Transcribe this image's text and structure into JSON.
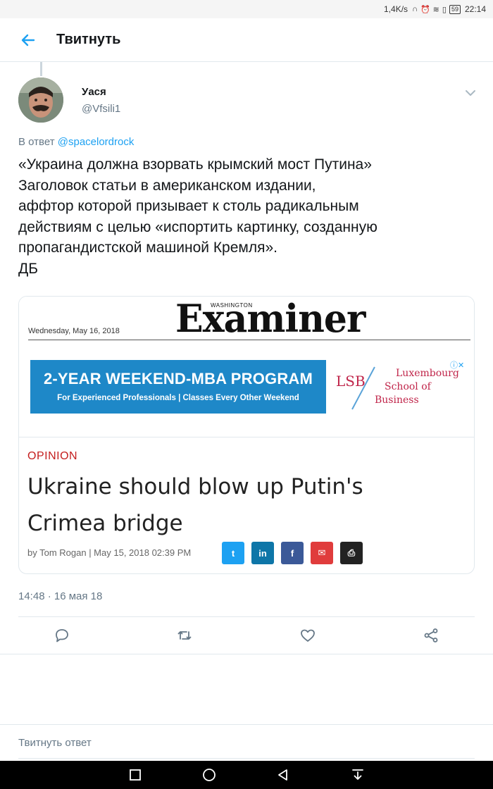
{
  "status_bar": {
    "speed": "1,4K/s",
    "icons": [
      "headphones-icon",
      "alarm-icon",
      "wifi-icon",
      "nfc-icon"
    ],
    "battery": "59",
    "time": "22:14"
  },
  "app_bar": {
    "back_icon": "arrow-left-icon",
    "title": "Твитнуть"
  },
  "tweet": {
    "author_name": "Уася",
    "author_handle": "@Vfsili1",
    "reply_prefix": "В ответ",
    "reply_mention": "@spacelordrock",
    "text_lines": [
      "«Украина должна взорвать крымский мост Путина»",
      "Заголовок статьи в американском издании,",
      "аффтор которой призывает к столь радикальным",
      "действиям с целью «испортить картинку, созданную",
      "пропагандистской машиной Кремля».",
      "ДБ"
    ],
    "timestamp": "14:48 · 16 мая 18"
  },
  "card": {
    "masthead_date": "Wednesday, May 16, 2018",
    "masthead_small": "WASHINGTON",
    "masthead_logo": "Examiner",
    "ad": {
      "title": "2-YEAR WEEKEND-MBA PROGRAM",
      "subtitle": "For Experienced Professionals  |  Classes Every Other Weekend",
      "brand_short": "LSB",
      "brand_lines": [
        "Luxembourg",
        "School of",
        "Business"
      ],
      "close": "ⓘ✕"
    },
    "section": "OPINION",
    "headline_lines": [
      "Ukraine should blow up Putin's",
      "Crimea bridge"
    ],
    "byline": "by Tom Rogan | May 15, 2018 02:39 PM",
    "share_buttons": [
      {
        "name": "twitter",
        "glyph": "t",
        "color": "#1da1f2"
      },
      {
        "name": "linkedin",
        "glyph": "in",
        "color": "#0e76a8"
      },
      {
        "name": "facebook",
        "glyph": "f",
        "color": "#3b5998"
      },
      {
        "name": "email",
        "glyph": "✉",
        "color": "#e03c3c"
      },
      {
        "name": "print",
        "glyph": "⎙",
        "color": "#222222"
      }
    ]
  },
  "actions": [
    "reply-icon",
    "retweet-icon",
    "like-icon",
    "share-icon"
  ],
  "reply_box": {
    "placeholder": "Твитнуть ответ"
  },
  "colors": {
    "accent": "#1da1f2",
    "muted": "#657786",
    "text": "#14171a",
    "ad_blue": "#1e88c8",
    "opinion_red": "#c41e1e"
  }
}
